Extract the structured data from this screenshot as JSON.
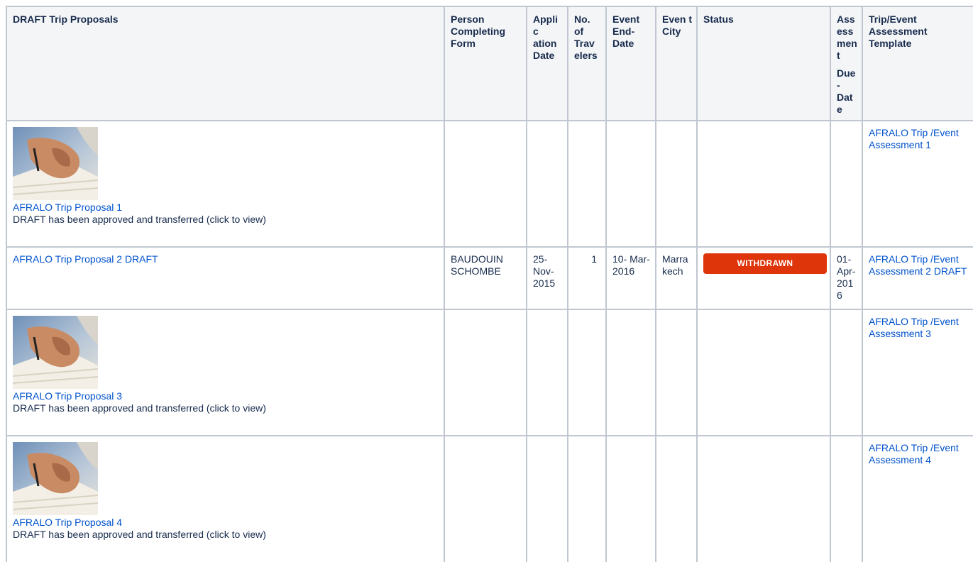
{
  "table": {
    "headers": {
      "proposal": "DRAFT Trip Proposals",
      "person": "Person Completing Form",
      "application_date": "Applic ation Date",
      "travelers": "No. of Trav elers",
      "event_end_date": "Event End- Date",
      "event_city": "Even t City",
      "status": "Status",
      "assessment_due_line1": "Ass ess ment",
      "assessment_due_line2": "Due- Date",
      "template": "Trip/Event Assessment Template"
    },
    "rows": [
      {
        "proposal_link": "AFRALO Trip Proposal 1",
        "note": "DRAFT has been approved and transferred (click to view)",
        "person": "",
        "application_date": "",
        "travelers": "",
        "event_end_date": "",
        "event_city": "",
        "status": "",
        "assessment_due": "",
        "template_link": "AFRALO Trip /Event Assessment 1"
      },
      {
        "proposal_link": "AFRALO Trip Proposal 2 DRAFT",
        "note": "",
        "person": "BAUDOUIN SCHOMBE",
        "application_date": "25- Nov- 2015",
        "travelers": "1",
        "event_end_date": "10- Mar- 2016",
        "event_city": "Marra kech",
        "status": "WITHDRAWN",
        "assessment_due": "01- Apr- 2016",
        "template_link": "AFRALO Trip /Event Assessment 2 DRAFT"
      },
      {
        "proposal_link": "AFRALO Trip Proposal 3",
        "note": "DRAFT has been approved and transferred (click to view)",
        "person": "",
        "application_date": "",
        "travelers": "",
        "event_end_date": "",
        "event_city": "",
        "status": "",
        "assessment_due": "",
        "template_link": "AFRALO Trip /Event Assessment 3"
      },
      {
        "proposal_link": "AFRALO Trip Proposal 4",
        "note": "DRAFT has been approved and transferred (click to view)",
        "person": "",
        "application_date": "",
        "travelers": "",
        "event_end_date": "",
        "event_city": "",
        "status": "",
        "assessment_due": "",
        "template_link": "AFRALO Trip /Event Assessment 4"
      }
    ]
  },
  "colors": {
    "header_bg": "#f4f5f7",
    "border": "#c1c7d0",
    "link": "#0052cc",
    "status_withdrawn": "#de350b"
  },
  "icons": {
    "thumbnail": "signing-document-image"
  }
}
